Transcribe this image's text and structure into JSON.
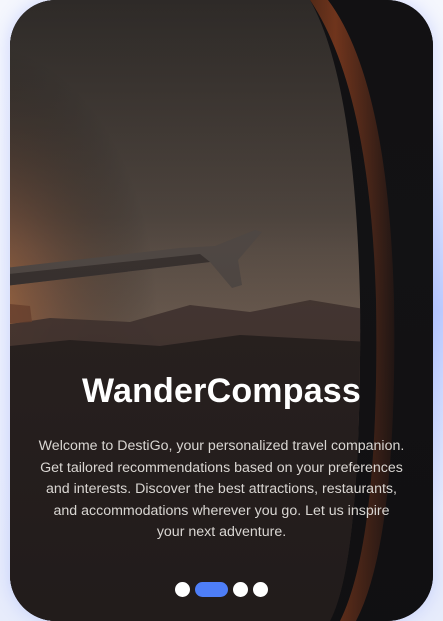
{
  "onboarding": {
    "title": "WanderCompass",
    "description": "Welcome to DestiGo, your personalized travel companion. Get tailored recommendations based on your preferences and interests. Discover the best attractions, restaurants, and accommodations wherever you go. Let us inspire your next adventure."
  },
  "pager": {
    "total": 4,
    "active_index": 1
  },
  "colors": {
    "accent": "#4e7ef7",
    "title": "#ffffff",
    "description": "#d9d6d2",
    "card_background": "#1b1a1d"
  },
  "background_image": "airplane-wing-through-window-at-sunset"
}
